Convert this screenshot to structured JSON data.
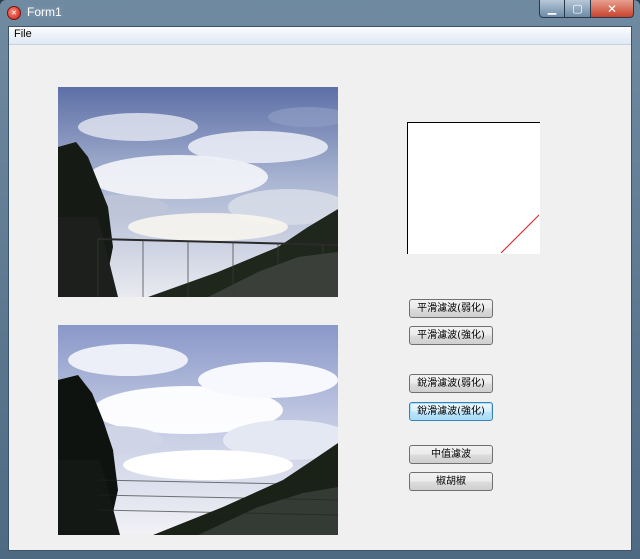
{
  "window": {
    "title": "Form1"
  },
  "menu": {
    "items": [
      "File"
    ]
  },
  "buttons": {
    "smooth_weak": "平滑濾波(弱化)",
    "smooth_strong": "平滑濾波(強化)",
    "sharpen_weak": "銳滑濾波(弱化)",
    "sharpen_strong": "銳滑濾波(強化)",
    "median": "中值濾波",
    "salt_pepper": "椒胡椒"
  },
  "colors": {
    "histogram_line": "#e02020",
    "accent_focus": "#3c7fb1"
  }
}
